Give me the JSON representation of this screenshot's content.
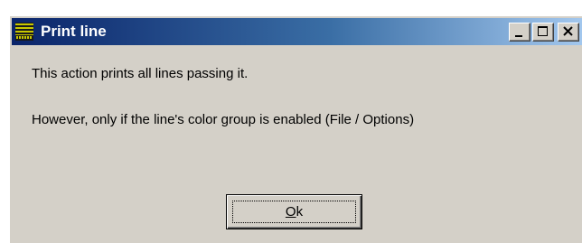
{
  "window": {
    "title": "Print line",
    "app_icon": "sfilter-logo-icon",
    "controls": {
      "minimize_icon": "minimize-icon",
      "maximize_icon": "maximize-icon",
      "close_icon": "close-icon"
    }
  },
  "dialog": {
    "message_line_1": "This action prints all lines passing it.",
    "message_line_2": "However, only if the line's color group is enabled (File / Options)"
  },
  "buttons": {
    "ok": {
      "label_mnemonic": "O",
      "label_rest": "k"
    }
  },
  "colors": {
    "titlebar_start": "#0a246a",
    "titlebar_end": "#a6caf0",
    "face": "#d4d0c8",
    "icon_stripes": "#c8c800"
  }
}
